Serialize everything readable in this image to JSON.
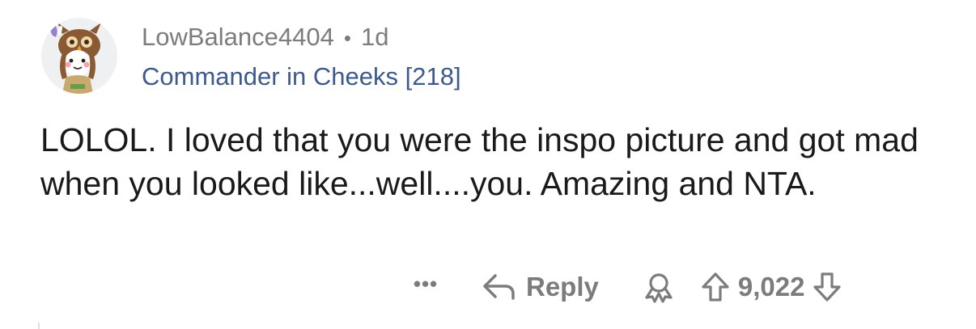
{
  "comment": {
    "author": "LowBalance4404",
    "separator": "•",
    "age": "1d",
    "flair": "Commander in Cheeks [218]",
    "body": "LOLOL.  I loved that you were the inspo picture and got mad when you looked like...well....you.  Amazing and NTA."
  },
  "actions": {
    "more_label": "•••",
    "reply_label": "Reply",
    "score": "9,022"
  },
  "icons": {
    "avatar": "snoo-owl-avatar",
    "reply": "reply-arrow-icon",
    "award": "award-icon",
    "upvote": "upvote-arrow-icon",
    "downvote": "downvote-arrow-icon"
  },
  "colors": {
    "meta_text": "#7c7c7c",
    "flair_text": "#3e5a8d",
    "body_text": "#1a1a1b",
    "avatar_bg": "#eef0f1"
  }
}
